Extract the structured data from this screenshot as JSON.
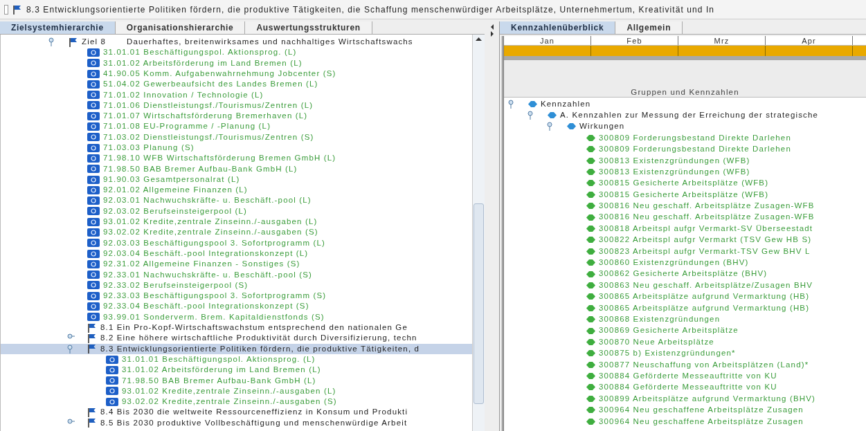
{
  "title_bar": {
    "text": "8.3 Entwicklungsorientierte Politiken fördern, die produktive Tätigkeiten, die Schaffung menschenwürdiger Arbeitsplätze, Unternehmertum, Kreativität und In"
  },
  "left_tabs": [
    {
      "label": "Zielsystemhierarchie",
      "selected": true
    },
    {
      "label": "Organisationshierarchie",
      "selected": false
    },
    {
      "label": "Auswertungsstrukturen",
      "selected": false
    }
  ],
  "left_tree": [
    {
      "kind": "goal",
      "label": "Ziel 8",
      "text": "Dauerhaftes, breitenwirksames und nachhaltiges Wirtschaftswachs",
      "expanded": true,
      "selected": false,
      "children": [
        {
          "kind": "account",
          "text": "31.01.01  Beschäftigungspol. Aktionsprog. (L)",
          "selected": false
        },
        {
          "kind": "account",
          "text": "31.01.02  Arbeitsförderung im Land Bremen (L)",
          "selected": false
        },
        {
          "kind": "account",
          "text": "41.90.05  Komm. Aufgabenwahrnehmung Jobcenter (S)",
          "selected": false
        },
        {
          "kind": "account",
          "text": "51.04.02  Gewerbeaufsicht des Landes Bremen (L)",
          "selected": false
        },
        {
          "kind": "account",
          "text": "71.01.02 Innovation / Technologie (L)",
          "selected": false
        },
        {
          "kind": "account",
          "text": "71.01.06 Dienstleistungsf./Tourismus/Zentren (L)",
          "selected": false
        },
        {
          "kind": "account",
          "text": "71.01.07 Wirtschaftsförderung Bremerhaven (L)",
          "selected": false
        },
        {
          "kind": "account",
          "text": "71.01.08 EU-Programme / -Planung (L)",
          "selected": false
        },
        {
          "kind": "account",
          "text": "71.03.02  Dienstleistungsf./Tourismus/Zentren (S)",
          "selected": false
        },
        {
          "kind": "account",
          "text": "71.03.03  Planung (S)",
          "selected": false
        },
        {
          "kind": "account",
          "text": "71.98.10  WFB Wirtschaftsförderung Bremen GmbH (L)",
          "selected": false
        },
        {
          "kind": "account",
          "text": "71.98.50  BAB Bremer Aufbau-Bank GmbH (L)",
          "selected": false
        },
        {
          "kind": "account",
          "text": "91.90.03  Gesamtpersonalrat (L)",
          "selected": false
        },
        {
          "kind": "account",
          "text": "92.01.02 Allgemeine Finanzen (L)",
          "selected": false
        },
        {
          "kind": "account",
          "text": "92.03.01  Nachwuchskräfte- u. Beschäft.-pool (L)",
          "selected": false
        },
        {
          "kind": "account",
          "text": "92.03.02  Berufseinsteigerpool (L)",
          "selected": false
        },
        {
          "kind": "account",
          "text": "93.01.02  Kredite,zentrale Zinseinn./-ausgaben (L)",
          "selected": false
        },
        {
          "kind": "account",
          "text": "93.02.02  Kredite,zentrale Zinseinn./-ausgaben (S)",
          "selected": false
        },
        {
          "kind": "account",
          "text": "92.03.03  Beschäftigungspool 3. Sofortprogramm (L)",
          "selected": false
        },
        {
          "kind": "account",
          "text": "92.03.04  Beschäft.-pool Integrationskonzept (L)",
          "selected": false
        },
        {
          "kind": "account",
          "text": "92.31.02  Allgemeine Finanzen - Sonstiges (S)",
          "selected": false
        },
        {
          "kind": "account",
          "text": "92.33.01  Nachwuchskräfte- u. Beschäft.-pool (S)",
          "selected": false
        },
        {
          "kind": "account",
          "text": "92.33.02  Berufseinsteigerpool (S)",
          "selected": false
        },
        {
          "kind": "account",
          "text": "92.33.03  Beschäftigungspool 3. Sofortprogramm (S)",
          "selected": false
        },
        {
          "kind": "account",
          "text": "92.33.04  Beschäft.-pool Integrationskonzept (S)",
          "selected": false
        },
        {
          "kind": "account",
          "text": "93.99.01  Sonderverm. Brem. Kapitaldienstfonds (S)",
          "selected": false
        },
        {
          "kind": "goal",
          "text": "8.1 Ein Pro-Kopf-Wirtschaftswachstum entsprechend den nationalen Ge",
          "selected": false
        },
        {
          "kind": "goal",
          "text": "8.2 Eine höhere wirtschaftliche Produktivität durch Diversifizierung, techn",
          "expanded": false,
          "selected": false
        },
        {
          "kind": "goal",
          "text": "8.3 Entwicklungsorientierte Politiken fördern, die produktive Tätigkeiten, d",
          "expanded": true,
          "selected": true,
          "children": [
            {
              "kind": "account",
              "text": "31.01.01  Beschäftigungspol. Aktionsprog. (L)",
              "selected": false
            },
            {
              "kind": "account",
              "text": "31.01.02  Arbeitsförderung im Land Bremen (L)",
              "selected": false
            },
            {
              "kind": "account",
              "text": "71.98.50  BAB Bremer Aufbau-Bank GmbH (L)",
              "selected": false
            },
            {
              "kind": "account",
              "text": "93.01.02  Kredite,zentrale Zinseinn./-ausgaben (L)",
              "selected": false
            },
            {
              "kind": "account",
              "text": "93.02.02  Kredite,zentrale Zinseinn./-ausgaben (S)",
              "selected": false
            }
          ]
        },
        {
          "kind": "goal",
          "text": "8.4 Bis 2030 die weltweite Ressourceneffizienz in Konsum und Produkti",
          "selected": false
        },
        {
          "kind": "goal",
          "text": "8.5 Bis 2030 produktive Vollbeschäftigung und menschenwürdige Arbeit",
          "expanded": false,
          "selected": false
        }
      ]
    }
  ],
  "right_tabs": [
    {
      "label": "Kennzahlenüberblick",
      "selected": true
    },
    {
      "label": "Allgemein",
      "selected": false
    }
  ],
  "months": [
    "Jan",
    "Feb",
    "Mrz",
    "Apr"
  ],
  "tree_header": "Gruppen und Kennzahlen",
  "right_tree": [
    {
      "kind": "group",
      "text": "Kennzahlen",
      "expanded": true,
      "children": [
        {
          "kind": "group",
          "text": "A. Kennzahlen zur Messung der Erreichung der strategische",
          "expanded": true,
          "children": [
            {
              "kind": "group",
              "text": "Wirkungen",
              "expanded": true,
              "children": [
                {
                  "kind": "indicator",
                  "text": "300809 Forderungsbestand Direkte Darlehen"
                },
                {
                  "kind": "indicator",
                  "text": "300809 Forderungsbestand Direkte Darlehen"
                },
                {
                  "kind": "indicator",
                  "text": "300813 Existenzgründungen (WFB)"
                },
                {
                  "kind": "indicator",
                  "text": "300813 Existenzgründungen (WFB)"
                },
                {
                  "kind": "indicator",
                  "text": "300815 Gesicherte Arbeitsplätze (WFB)"
                },
                {
                  "kind": "indicator",
                  "text": "300815 Gesicherte Arbeitsplätze (WFB)"
                },
                {
                  "kind": "indicator",
                  "text": "300816 Neu geschaff. Arbeitsplätze Zusagen-WFB"
                },
                {
                  "kind": "indicator",
                  "text": "300816 Neu geschaff. Arbeitsplätze Zusagen-WFB"
                },
                {
                  "kind": "indicator",
                  "text": "300818 Arbeitspl aufgr Vermarkt-SV Überseestadt"
                },
                {
                  "kind": "indicator",
                  "text": "300822 Arbeitspl aufgr Vermarkt (TSV Gew HB S)"
                },
                {
                  "kind": "indicator",
                  "text": "300823 Arbeitspl aufgr Vermarkt-TSV Gew BHV L"
                },
                {
                  "kind": "indicator",
                  "text": "300860 Existenzgründungen (BHV)"
                },
                {
                  "kind": "indicator",
                  "text": "300862 Gesicherte Arbeitsplätze (BHV)"
                },
                {
                  "kind": "indicator",
                  "text": "300863 Neu geschaff. Arbeitsplätze/Zusagen BHV"
                },
                {
                  "kind": "indicator",
                  "text": "300865 Arbeitsplätze aufgrund Vermarktung (HB)"
                },
                {
                  "kind": "indicator",
                  "text": "300865 Arbeitsplätze aufgrund Vermarktung (HB)"
                },
                {
                  "kind": "indicator",
                  "text": "300868 Existenzgründungen"
                },
                {
                  "kind": "indicator",
                  "text": "300869 Gesicherte Arbeitsplätze"
                },
                {
                  "kind": "indicator",
                  "text": "300870 Neue Arbeitsplätze"
                },
                {
                  "kind": "indicator",
                  "text": "300875 b) Existenzgründungen*"
                },
                {
                  "kind": "indicator",
                  "text": "300877 Neuschaffung von Arbeitsplätzen (Land)*"
                },
                {
                  "kind": "indicator",
                  "text": "300884 Geförderte Messeauftritte von KU"
                },
                {
                  "kind": "indicator",
                  "text": "300884 Geförderte Messeauftritte von KU"
                },
                {
                  "kind": "indicator",
                  "text": "300899 Arbeitsplätze aufgrund Vermarktung (BHV)"
                },
                {
                  "kind": "indicator",
                  "text": "300964 Neu geschaffene Arbeitsplätze Zusagen"
                },
                {
                  "kind": "indicator",
                  "text": "300964 Neu geschaffene Arbeitsplätze Zusagen"
                }
              ]
            }
          ]
        }
      ]
    }
  ]
}
